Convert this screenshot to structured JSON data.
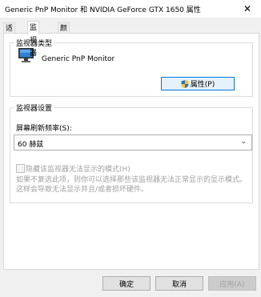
{
  "window": {
    "title": "Generic PnP Monitor 和 NVIDIA GeForce GTX 1650 属性",
    "close_glyph": "✕"
  },
  "tabs": [
    {
      "label": "适配器",
      "active": false
    },
    {
      "label": "监视器",
      "active": true
    },
    {
      "label": "颜色管理",
      "active": false
    }
  ],
  "monitor_type": {
    "group_label": "监视器类型",
    "name": "Generic PnP Monitor",
    "properties_button": "属性(P)",
    "icon": "monitor-icon"
  },
  "monitor_settings": {
    "group_label": "监视器设置",
    "refresh_rate_label": "屏幕刷新频率(S):",
    "refresh_rate_value": "60 赫兹",
    "hide_modes_label": "隐藏该监视器无法显示的模式(H)",
    "hide_modes_checked": false,
    "hide_modes_enabled": false,
    "description": "如果不复选此项，则你可以选择那些该监视器无法正常显示的显示模式。这样会导致无法显示并且/或者损坏硬件。"
  },
  "footer": {
    "ok": "确定",
    "cancel": "取消",
    "apply": "应用(A)"
  },
  "colors": {
    "accent": "#0078d7",
    "dialog_bg": "#f0f0f0",
    "disabled_text": "#a0a0a0"
  }
}
